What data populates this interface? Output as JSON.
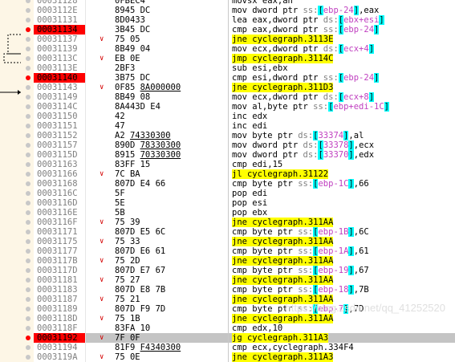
{
  "rows": [
    {
      "addr": "00031128",
      "bytes": "0FBEC4",
      "ins": "movsx eax,ah",
      "bp": false,
      "jmp": false
    },
    {
      "addr": "0003112E",
      "bytes": "8945 DC",
      "ins": "mov dword ptr ss:[ebp-24],eax",
      "bp": false,
      "jmp": false
    },
    {
      "addr": "00031131",
      "bytes": "8D0433",
      "ins": "lea eax,dword ptr ds:[ebx+esi]",
      "bp": false,
      "jmp": false
    },
    {
      "addr": "00031134",
      "bytes": "3B45 DC",
      "ins": "cmp eax,dword ptr ss:[ebp-24]",
      "bp": true,
      "jmp": false
    },
    {
      "addr": "00031137",
      "bytes": "75 05",
      "ins": "jne cyclegraph.3113E",
      "bp": false,
      "jmp": true
    },
    {
      "addr": "00031139",
      "bytes": "8B49 04",
      "ins": "mov ecx,dword ptr ds:[ecx+4]",
      "bp": false,
      "jmp": false
    },
    {
      "addr": "0003113C",
      "bytes": "EB 0E",
      "ins": "jmp cyclegraph.3114C",
      "bp": false,
      "jmp": true
    },
    {
      "addr": "0003113E",
      "bytes": "2BF3",
      "ins": "sub esi,ebx",
      "bp": false,
      "jmp": false
    },
    {
      "addr": "00031140",
      "bytes": "3B75 DC",
      "ins": "cmp esi,dword ptr ss:[ebp-24]",
      "bp": true,
      "jmp": false
    },
    {
      "addr": "00031143",
      "bytes": "0F85 8A000000",
      "ins": "jne cyclegraph.311D3",
      "bp": false,
      "jmp": true
    },
    {
      "addr": "00031149",
      "bytes": "8B49 08",
      "ins": "mov ecx,dword ptr ds:[ecx+8]",
      "bp": false,
      "jmp": false
    },
    {
      "addr": "0003114C",
      "bytes": "8A443D E4",
      "ins": "mov al,byte ptr ss:[ebp+edi-1C]",
      "bp": false,
      "jmp": false
    },
    {
      "addr": "00031150",
      "bytes": "42",
      "ins": "inc edx",
      "bp": false,
      "jmp": false
    },
    {
      "addr": "00031151",
      "bytes": "47",
      "ins": "inc edi",
      "bp": false,
      "jmp": false
    },
    {
      "addr": "00031152",
      "bytes": "A2 74330300",
      "ins": "mov byte ptr ds:[33374],al",
      "bp": false,
      "jmp": false
    },
    {
      "addr": "00031157",
      "bytes": "890D 78330300",
      "ins": "mov dword ptr ds:[33378],ecx",
      "bp": false,
      "jmp": false
    },
    {
      "addr": "0003115D",
      "bytes": "8915 70330300",
      "ins": "mov dword ptr ds:[33370],edx",
      "bp": false,
      "jmp": false
    },
    {
      "addr": "00031163",
      "bytes": "83FF 15",
      "ins": "cmp edi,15",
      "bp": false,
      "jmp": false
    },
    {
      "addr": "00031166",
      "bytes": "7C BA",
      "ins": "jl cyclegraph.31122",
      "bp": false,
      "jmp": true
    },
    {
      "addr": "00031168",
      "bytes": "807D E4 66",
      "ins": "cmp byte ptr ss:[ebp-1C],66",
      "bp": false,
      "jmp": false
    },
    {
      "addr": "0003116C",
      "bytes": "5F",
      "ins": "pop edi",
      "bp": false,
      "jmp": false
    },
    {
      "addr": "0003116D",
      "bytes": "5E",
      "ins": "pop esi",
      "bp": false,
      "jmp": false
    },
    {
      "addr": "0003116E",
      "bytes": "5B",
      "ins": "pop ebx",
      "bp": false,
      "jmp": false
    },
    {
      "addr": "0003116F",
      "bytes": "75 39",
      "ins": "jne cyclegraph.311AA",
      "bp": false,
      "jmp": true
    },
    {
      "addr": "00031171",
      "bytes": "807D E5 6C",
      "ins": "cmp byte ptr ss:[ebp-1B],6C",
      "bp": false,
      "jmp": false
    },
    {
      "addr": "00031175",
      "bytes": "75 33",
      "ins": "jne cyclegraph.311AA",
      "bp": false,
      "jmp": true
    },
    {
      "addr": "00031177",
      "bytes": "807D E6 61",
      "ins": "cmp byte ptr ss:[ebp-1A],61",
      "bp": false,
      "jmp": false
    },
    {
      "addr": "0003117B",
      "bytes": "75 2D",
      "ins": "jne cyclegraph.311AA",
      "bp": false,
      "jmp": true
    },
    {
      "addr": "0003117D",
      "bytes": "807D E7 67",
      "ins": "cmp byte ptr ss:[ebp-19],67",
      "bp": false,
      "jmp": false
    },
    {
      "addr": "00031181",
      "bytes": "75 27",
      "ins": "jne cyclegraph.311AA",
      "bp": false,
      "jmp": true
    },
    {
      "addr": "00031183",
      "bytes": "807D E8 7B",
      "ins": "cmp byte ptr ss:[ebp-18],7B",
      "bp": false,
      "jmp": false
    },
    {
      "addr": "00031187",
      "bytes": "75 21",
      "ins": "jne cyclegraph.311AA",
      "bp": false,
      "jmp": true
    },
    {
      "addr": "00031189",
      "bytes": "807D F9 7D",
      "ins": "cmp byte ptr ss:[ebp-7],7D",
      "bp": false,
      "jmp": false
    },
    {
      "addr": "0003118D",
      "bytes": "75 1B",
      "ins": "jne cyclegraph.311AA",
      "bp": false,
      "jmp": true
    },
    {
      "addr": "0003118F",
      "bytes": "83FA 10",
      "ins": "cmp edx,10",
      "bp": false,
      "jmp": false
    },
    {
      "addr": "00031192",
      "bytes": "7F 0F",
      "ins": "jg cyclegraph.311A3",
      "bp": true,
      "jmp": true,
      "selected": true
    },
    {
      "addr": "00031194",
      "bytes": "81F9 F4340300",
      "ins": "cmp ecx,cyclegraph.334F4",
      "bp": false,
      "jmp": false
    },
    {
      "addr": "0003119A",
      "bytes": "75 0E",
      "ins": "jne cyclegraph.311A3",
      "bp": false,
      "jmp": true
    }
  ],
  "watermark": "https://blog.csdn.net/qq_41252520",
  "colors": {
    "breakpoint": "#ff0000",
    "jump_highlight": "#ffff00",
    "operand_box": "#00ffff",
    "gutter": "#fdf6e6",
    "selection": "#c4c4c4"
  }
}
